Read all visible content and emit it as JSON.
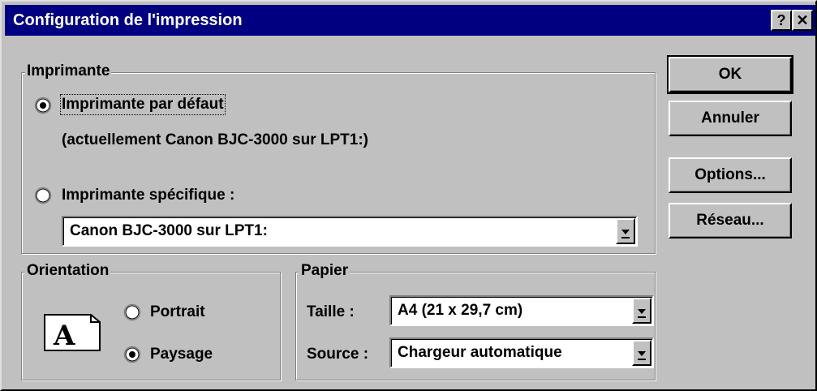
{
  "window": {
    "title": "Configuration de l'impression",
    "help_glyph": "?",
    "close_glyph": "✕"
  },
  "printer": {
    "group_label": "Imprimante",
    "default_option_label": "Imprimante par défaut",
    "default_current": "(actuellement Canon BJC-3000 sur LPT1:)",
    "specific_option_label": "Imprimante spécifique :",
    "specific_value": "Canon BJC-3000 sur LPT1:",
    "selected": "default"
  },
  "orientation": {
    "group_label": "Orientation",
    "icon_letter": "A",
    "portrait_label": "Portrait",
    "landscape_label": "Paysage",
    "selected": "landscape"
  },
  "paper": {
    "group_label": "Papier",
    "size_label": "Taille :",
    "size_value": "A4 (21 x 29,7 cm)",
    "source_label": "Source :",
    "source_value": "Chargeur automatique"
  },
  "buttons": {
    "ok": "OK",
    "cancel": "Annuler",
    "options": "Options...",
    "network": "Réseau..."
  }
}
